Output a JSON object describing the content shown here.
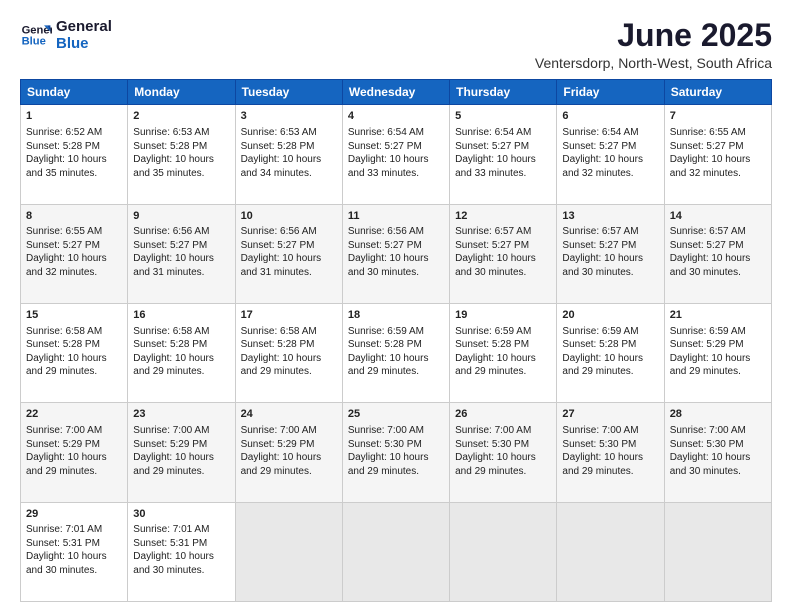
{
  "header": {
    "logo_line1": "General",
    "logo_line2": "Blue",
    "month_title": "June 2025",
    "location": "Ventersdorp, North-West, South Africa"
  },
  "weekdays": [
    "Sunday",
    "Monday",
    "Tuesday",
    "Wednesday",
    "Thursday",
    "Friday",
    "Saturday"
  ],
  "weeks": [
    [
      {
        "day": "1",
        "text": "Sunrise: 6:52 AM\nSunset: 5:28 PM\nDaylight: 10 hours\nand 35 minutes."
      },
      {
        "day": "2",
        "text": "Sunrise: 6:53 AM\nSunset: 5:28 PM\nDaylight: 10 hours\nand 35 minutes."
      },
      {
        "day": "3",
        "text": "Sunrise: 6:53 AM\nSunset: 5:28 PM\nDaylight: 10 hours\nand 34 minutes."
      },
      {
        "day": "4",
        "text": "Sunrise: 6:54 AM\nSunset: 5:27 PM\nDaylight: 10 hours\nand 33 minutes."
      },
      {
        "day": "5",
        "text": "Sunrise: 6:54 AM\nSunset: 5:27 PM\nDaylight: 10 hours\nand 33 minutes."
      },
      {
        "day": "6",
        "text": "Sunrise: 6:54 AM\nSunset: 5:27 PM\nDaylight: 10 hours\nand 32 minutes."
      },
      {
        "day": "7",
        "text": "Sunrise: 6:55 AM\nSunset: 5:27 PM\nDaylight: 10 hours\nand 32 minutes."
      }
    ],
    [
      {
        "day": "8",
        "text": "Sunrise: 6:55 AM\nSunset: 5:27 PM\nDaylight: 10 hours\nand 32 minutes."
      },
      {
        "day": "9",
        "text": "Sunrise: 6:56 AM\nSunset: 5:27 PM\nDaylight: 10 hours\nand 31 minutes."
      },
      {
        "day": "10",
        "text": "Sunrise: 6:56 AM\nSunset: 5:27 PM\nDaylight: 10 hours\nand 31 minutes."
      },
      {
        "day": "11",
        "text": "Sunrise: 6:56 AM\nSunset: 5:27 PM\nDaylight: 10 hours\nand 30 minutes."
      },
      {
        "day": "12",
        "text": "Sunrise: 6:57 AM\nSunset: 5:27 PM\nDaylight: 10 hours\nand 30 minutes."
      },
      {
        "day": "13",
        "text": "Sunrise: 6:57 AM\nSunset: 5:27 PM\nDaylight: 10 hours\nand 30 minutes."
      },
      {
        "day": "14",
        "text": "Sunrise: 6:57 AM\nSunset: 5:27 PM\nDaylight: 10 hours\nand 30 minutes."
      }
    ],
    [
      {
        "day": "15",
        "text": "Sunrise: 6:58 AM\nSunset: 5:28 PM\nDaylight: 10 hours\nand 29 minutes."
      },
      {
        "day": "16",
        "text": "Sunrise: 6:58 AM\nSunset: 5:28 PM\nDaylight: 10 hours\nand 29 minutes."
      },
      {
        "day": "17",
        "text": "Sunrise: 6:58 AM\nSunset: 5:28 PM\nDaylight: 10 hours\nand 29 minutes."
      },
      {
        "day": "18",
        "text": "Sunrise: 6:59 AM\nSunset: 5:28 PM\nDaylight: 10 hours\nand 29 minutes."
      },
      {
        "day": "19",
        "text": "Sunrise: 6:59 AM\nSunset: 5:28 PM\nDaylight: 10 hours\nand 29 minutes."
      },
      {
        "day": "20",
        "text": "Sunrise: 6:59 AM\nSunset: 5:28 PM\nDaylight: 10 hours\nand 29 minutes."
      },
      {
        "day": "21",
        "text": "Sunrise: 6:59 AM\nSunset: 5:29 PM\nDaylight: 10 hours\nand 29 minutes."
      }
    ],
    [
      {
        "day": "22",
        "text": "Sunrise: 7:00 AM\nSunset: 5:29 PM\nDaylight: 10 hours\nand 29 minutes."
      },
      {
        "day": "23",
        "text": "Sunrise: 7:00 AM\nSunset: 5:29 PM\nDaylight: 10 hours\nand 29 minutes."
      },
      {
        "day": "24",
        "text": "Sunrise: 7:00 AM\nSunset: 5:29 PM\nDaylight: 10 hours\nand 29 minutes."
      },
      {
        "day": "25",
        "text": "Sunrise: 7:00 AM\nSunset: 5:30 PM\nDaylight: 10 hours\nand 29 minutes."
      },
      {
        "day": "26",
        "text": "Sunrise: 7:00 AM\nSunset: 5:30 PM\nDaylight: 10 hours\nand 29 minutes."
      },
      {
        "day": "27",
        "text": "Sunrise: 7:00 AM\nSunset: 5:30 PM\nDaylight: 10 hours\nand 29 minutes."
      },
      {
        "day": "28",
        "text": "Sunrise: 7:00 AM\nSunset: 5:30 PM\nDaylight: 10 hours\nand 30 minutes."
      }
    ],
    [
      {
        "day": "29",
        "text": "Sunrise: 7:01 AM\nSunset: 5:31 PM\nDaylight: 10 hours\nand 30 minutes."
      },
      {
        "day": "30",
        "text": "Sunrise: 7:01 AM\nSunset: 5:31 PM\nDaylight: 10 hours\nand 30 minutes."
      },
      {
        "day": "",
        "text": ""
      },
      {
        "day": "",
        "text": ""
      },
      {
        "day": "",
        "text": ""
      },
      {
        "day": "",
        "text": ""
      },
      {
        "day": "",
        "text": ""
      }
    ]
  ]
}
